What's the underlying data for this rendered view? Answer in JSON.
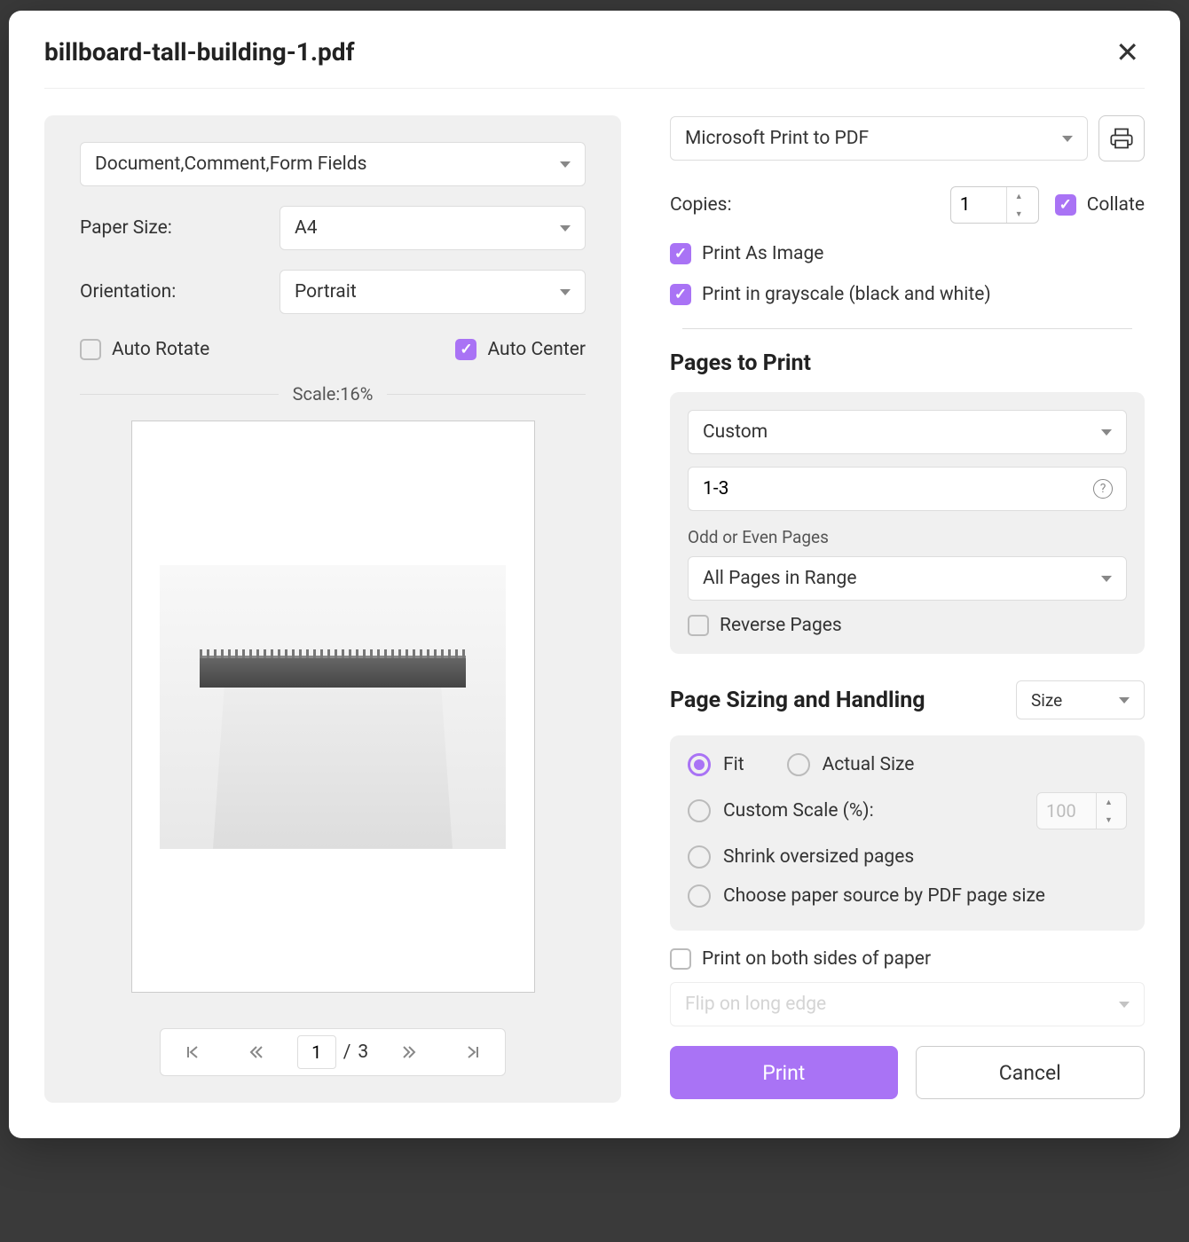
{
  "title": "billboard-tall-building-1.pdf",
  "left": {
    "content_select": "Document,Comment,Form Fields",
    "paper_size_label": "Paper Size:",
    "paper_size_value": "A4",
    "orientation_label": "Orientation:",
    "orientation_value": "Portrait",
    "auto_rotate": "Auto Rotate",
    "auto_center": "Auto Center",
    "scale_text": "Scale:16%",
    "pager": {
      "current": "1",
      "sep": "/",
      "total": "3"
    }
  },
  "right": {
    "printer": "Microsoft Print to PDF",
    "copies_label": "Copies:",
    "copies_value": "1",
    "collate": "Collate",
    "print_as_image": "Print As Image",
    "grayscale": "Print in grayscale (black and white)",
    "pages_title": "Pages to Print",
    "range_mode": "Custom",
    "range_value": "1-3",
    "odd_even_label": "Odd or Even Pages",
    "odd_even_value": "All Pages in Range",
    "reverse": "Reverse Pages",
    "sizing_title": "Page Sizing and Handling",
    "size_select": "Size",
    "fit": "Fit",
    "actual": "Actual Size",
    "custom_scale": "Custom Scale (%):",
    "custom_scale_value": "100",
    "shrink": "Shrink oversized pages",
    "paper_source": "Choose paper source by PDF page size",
    "both_sides": "Print on both sides of paper",
    "flip": "Flip on long edge",
    "print_btn": "Print",
    "cancel_btn": "Cancel"
  }
}
